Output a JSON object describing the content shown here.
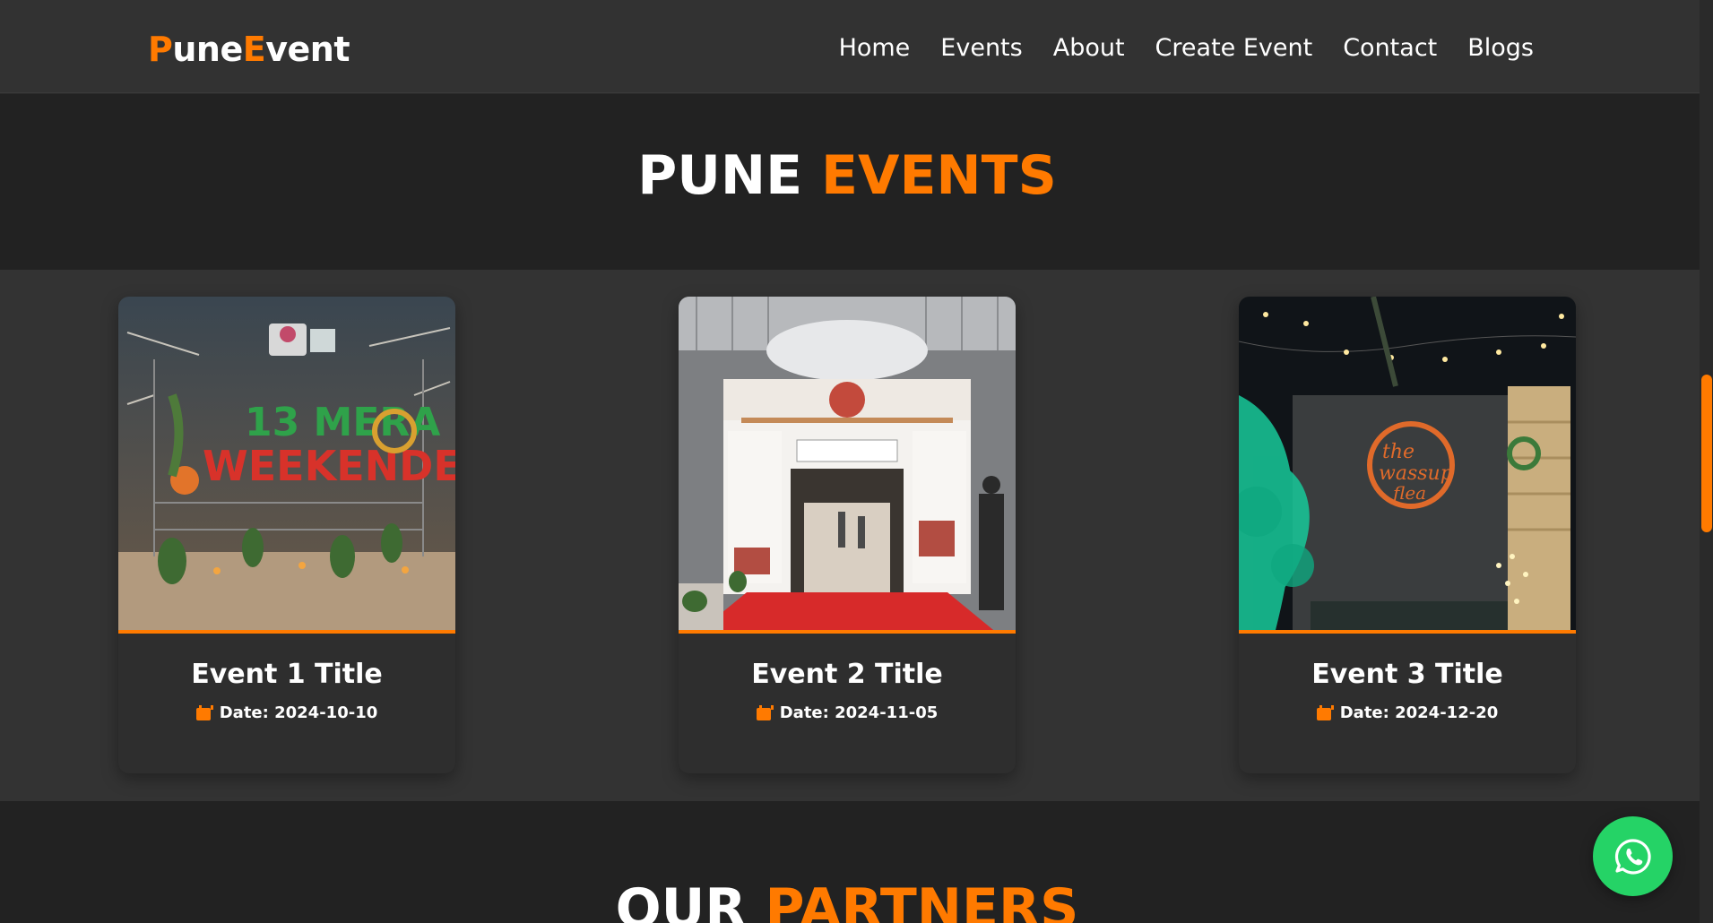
{
  "brand": {
    "logo_part1": "P",
    "logo_part2": "une",
    "logo_part3": "E",
    "logo_part4": "vent"
  },
  "nav": {
    "items": [
      {
        "label": "Home"
      },
      {
        "label": "Events"
      },
      {
        "label": "About"
      },
      {
        "label": "Create Event"
      },
      {
        "label": "Contact"
      },
      {
        "label": "Blogs"
      }
    ]
  },
  "hero": {
    "title_white": "PUNE ",
    "title_accent": "EVENTS"
  },
  "events": [
    {
      "title": "Event 1 Title",
      "date": "Date: 2024-10-10"
    },
    {
      "title": "Event 2 Title",
      "date": "Date: 2024-11-05"
    },
    {
      "title": "Event 3 Title",
      "date": "Date: 2024-12-20"
    }
  ],
  "partners": {
    "title_white": "OUR ",
    "title_accent": "PARTNERS"
  },
  "colors": {
    "accent": "#ff7a00",
    "whatsapp": "#25d366",
    "header_bg": "#323232",
    "band_dark": "#222222",
    "band_mid": "#333333"
  },
  "icons": {
    "calendar": "calendar-icon",
    "whatsapp": "whatsapp-icon"
  }
}
